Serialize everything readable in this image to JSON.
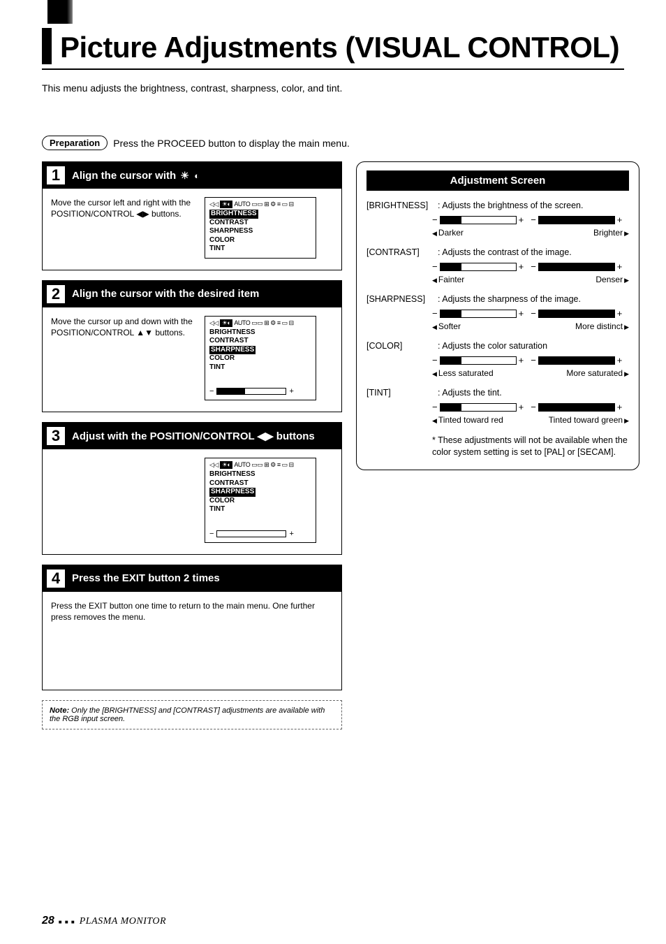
{
  "page_title": "Picture Adjustments (VISUAL CONTROL)",
  "intro": "This menu adjusts the brightness, contrast, sharpness, color, and tint.",
  "preparation": {
    "label": "Preparation",
    "text": "Press the PROCEED button to display the main menu."
  },
  "menu_items": {
    "brightness": "BRIGHTNESS",
    "contrast": "CONTRAST",
    "sharpness": "SHARPNESS",
    "color": "COLOR",
    "tint": "TINT"
  },
  "steps": [
    {
      "num": "1",
      "title_prefix": "Align the cursor with ",
      "desc": "Move the cursor left and right with the POSITION/CONTROL ◀▶ buttons."
    },
    {
      "num": "2",
      "title": "Align the cursor with the desired item",
      "desc": "Move the cursor up and down with the POSITION/CONTROL ▲▼ buttons."
    },
    {
      "num": "3",
      "title": "Adjust with the POSITION/CONTROL ◀▶ buttons"
    },
    {
      "num": "4",
      "title": "Press the EXIT button 2 times",
      "desc": "Press the EXIT button one time to return to the main menu. One further press removes the menu."
    }
  ],
  "note": {
    "label": "Note:",
    "text": "Only the [BRIGHTNESS] and [CONTRAST] adjustments are available with the RGB input screen."
  },
  "adjustment_screen": {
    "title": "Adjustment Screen",
    "items": [
      {
        "key": "[BRIGHTNESS]",
        "desc": ": Adjusts the brightness of the screen.",
        "left": "Darker",
        "right": "Brighter"
      },
      {
        "key": "[CONTRAST]",
        "desc": ": Adjusts the contrast of the image.",
        "left": "Fainter",
        "right": "Denser"
      },
      {
        "key": "[SHARPNESS]",
        "desc": ": Adjusts the sharpness of the image.",
        "left": "Softer",
        "right": "More distinct"
      },
      {
        "key": "[COLOR]",
        "desc": ": Adjusts the color saturation",
        "left": "Less saturated",
        "right": "More saturated"
      },
      {
        "key": "[TINT]",
        "desc": ": Adjusts the tint.",
        "left": "Tinted toward red",
        "right": "Tinted toward green"
      }
    ],
    "footnote": "* These adjustments will not be available when the color system setting is set to [PAL] or [SECAM]."
  },
  "footer": {
    "page": "28",
    "label": "PLASMA MONITOR"
  }
}
